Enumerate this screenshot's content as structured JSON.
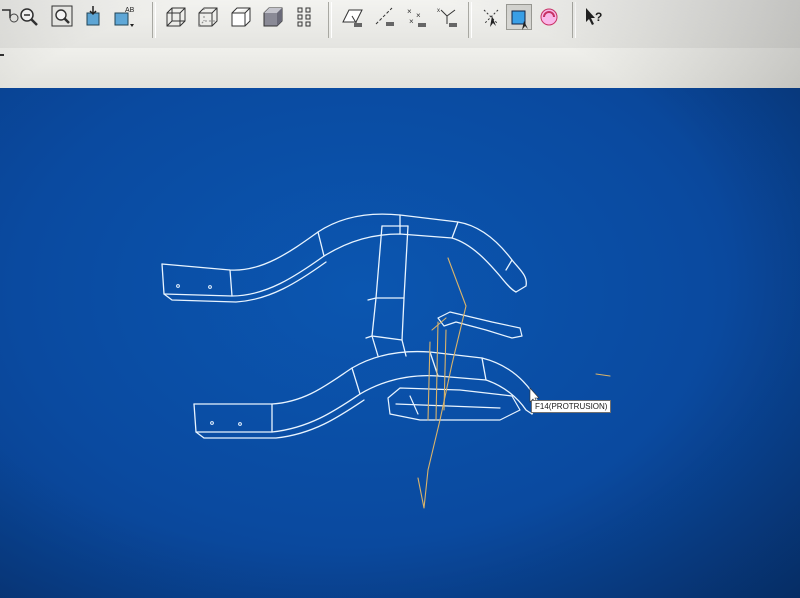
{
  "toolbar": {
    "buttons": [
      {
        "icon": "refit-icon"
      },
      {
        "icon": "zoom-out-icon"
      },
      {
        "icon": "zoom-in-window-icon"
      },
      {
        "icon": "orient-icon"
      },
      {
        "icon": "saved-views-icon",
        "label": "AB"
      },
      {
        "icon": "wireframe-icon"
      },
      {
        "icon": "hidden-line-icon"
      },
      {
        "icon": "no-hidden-icon"
      },
      {
        "icon": "shading-icon"
      },
      {
        "icon": "model-tree-icon"
      },
      {
        "icon": "datum-planes-icon"
      },
      {
        "icon": "datum-axes-icon"
      },
      {
        "icon": "datum-points-icon"
      },
      {
        "icon": "coordinate-systems-icon"
      },
      {
        "icon": "spin-center-icon"
      },
      {
        "icon": "annotation-icon"
      },
      {
        "icon": "appearance-icon"
      },
      {
        "icon": "context-help-icon",
        "label": "?"
      }
    ]
  },
  "viewport": {
    "background": "#0a4aa0",
    "wireframe_color": "#e8f4ff",
    "datum_color": "#d9b36a",
    "tooltip_text": "F14(PROTRUSION)"
  }
}
